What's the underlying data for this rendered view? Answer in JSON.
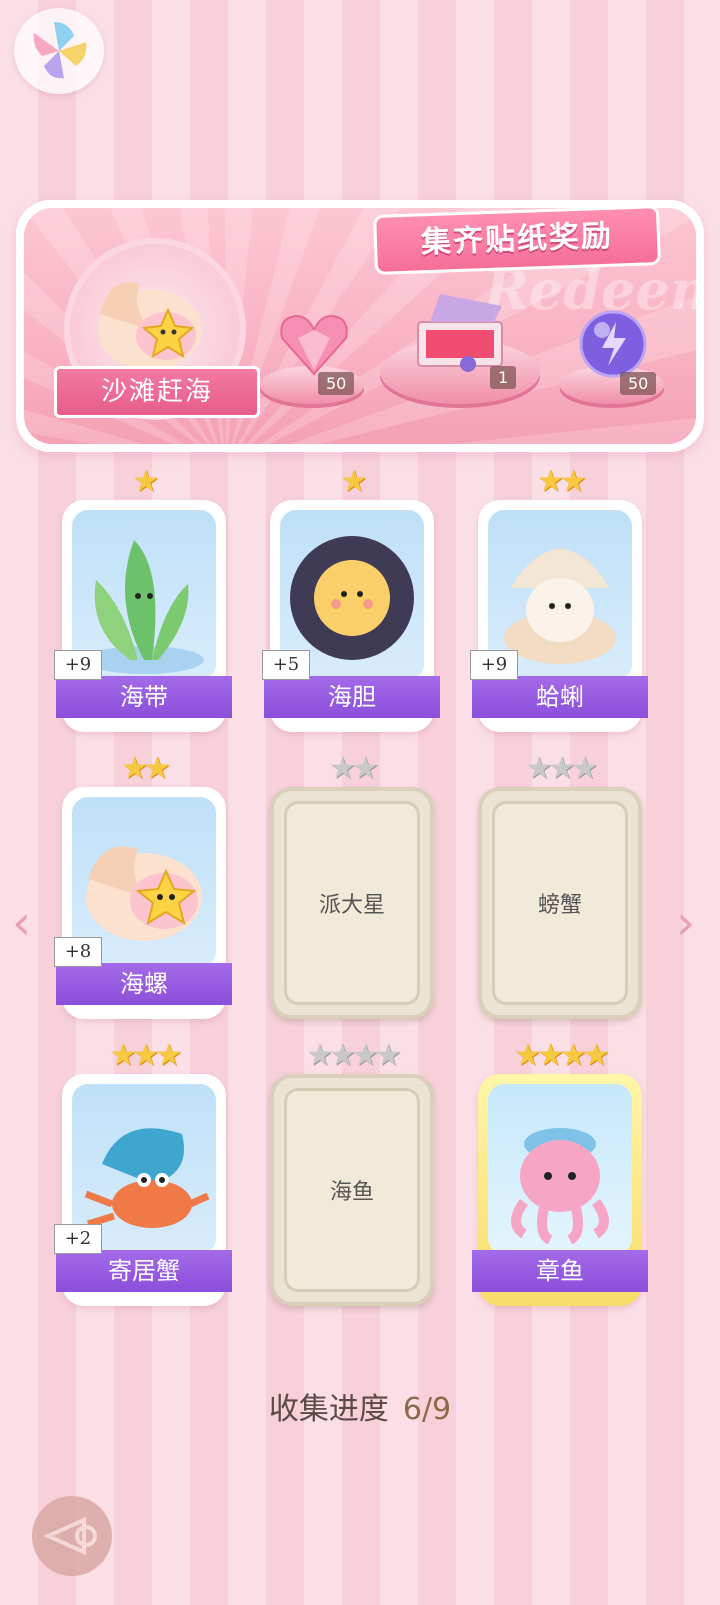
{
  "banner": {
    "title": "集齐贴纸奖励",
    "deco_text": "Redeem",
    "theme_label": "沙滩赶海",
    "rewards": [
      {
        "icon": "pink-heart-gem-icon",
        "count": "50"
      },
      {
        "icon": "gift-box-icon",
        "count": "1"
      },
      {
        "icon": "purple-energy-orb-icon",
        "count": "50"
      }
    ]
  },
  "cards": [
    {
      "name": "海带",
      "stars": 1,
      "count": "+9",
      "collected": true,
      "icon": "seaweed-icon"
    },
    {
      "name": "海胆",
      "stars": 1,
      "count": "+5",
      "collected": true,
      "icon": "sea-urchin-icon"
    },
    {
      "name": "蛤蜊",
      "stars": 2,
      "count": "+9",
      "collected": true,
      "icon": "clam-icon"
    },
    {
      "name": "海螺",
      "stars": 2,
      "count": "+8",
      "collected": true,
      "icon": "conch-icon"
    },
    {
      "name": "派大星",
      "stars": 2,
      "count": "",
      "collected": false,
      "icon": ""
    },
    {
      "name": "螃蟹",
      "stars": 3,
      "count": "",
      "collected": false,
      "icon": ""
    },
    {
      "name": "寄居蟹",
      "stars": 3,
      "count": "+2",
      "collected": true,
      "icon": "hermit-crab-icon"
    },
    {
      "name": "海鱼",
      "stars": 4,
      "count": "",
      "collected": false,
      "icon": ""
    },
    {
      "name": "章鱼",
      "stars": 4,
      "count": "",
      "collected": true,
      "icon": "octopus-icon"
    }
  ],
  "progress": {
    "label": "收集进度",
    "value": "6/9"
  },
  "nav": {
    "prev": "‹",
    "next": "›"
  },
  "colors": {
    "accent_pink": "#f56f98",
    "name_purple": "#9a5ee3",
    "star_gold": "#f7c940"
  }
}
